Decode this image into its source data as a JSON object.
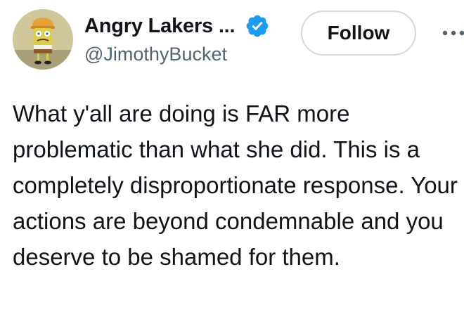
{
  "author": {
    "display_name": "Angry Lakers ...",
    "handle": "@JimothyBucket",
    "verified": true,
    "avatar_icon": "spongebob-avatar"
  },
  "actions": {
    "follow_label": "Follow",
    "more_icon": "more-horizontal-icon"
  },
  "tweet": {
    "text": "What y'all are doing is FAR more problematic than what she did. This is a completely disproportionate response. Your actions are beyond condemnable and you deserve to be shamed for them."
  },
  "colors": {
    "verified_badge": "#1d9bf0",
    "handle_text": "#536471",
    "body_text": "#0f1419",
    "follow_border": "#cfd9de"
  }
}
